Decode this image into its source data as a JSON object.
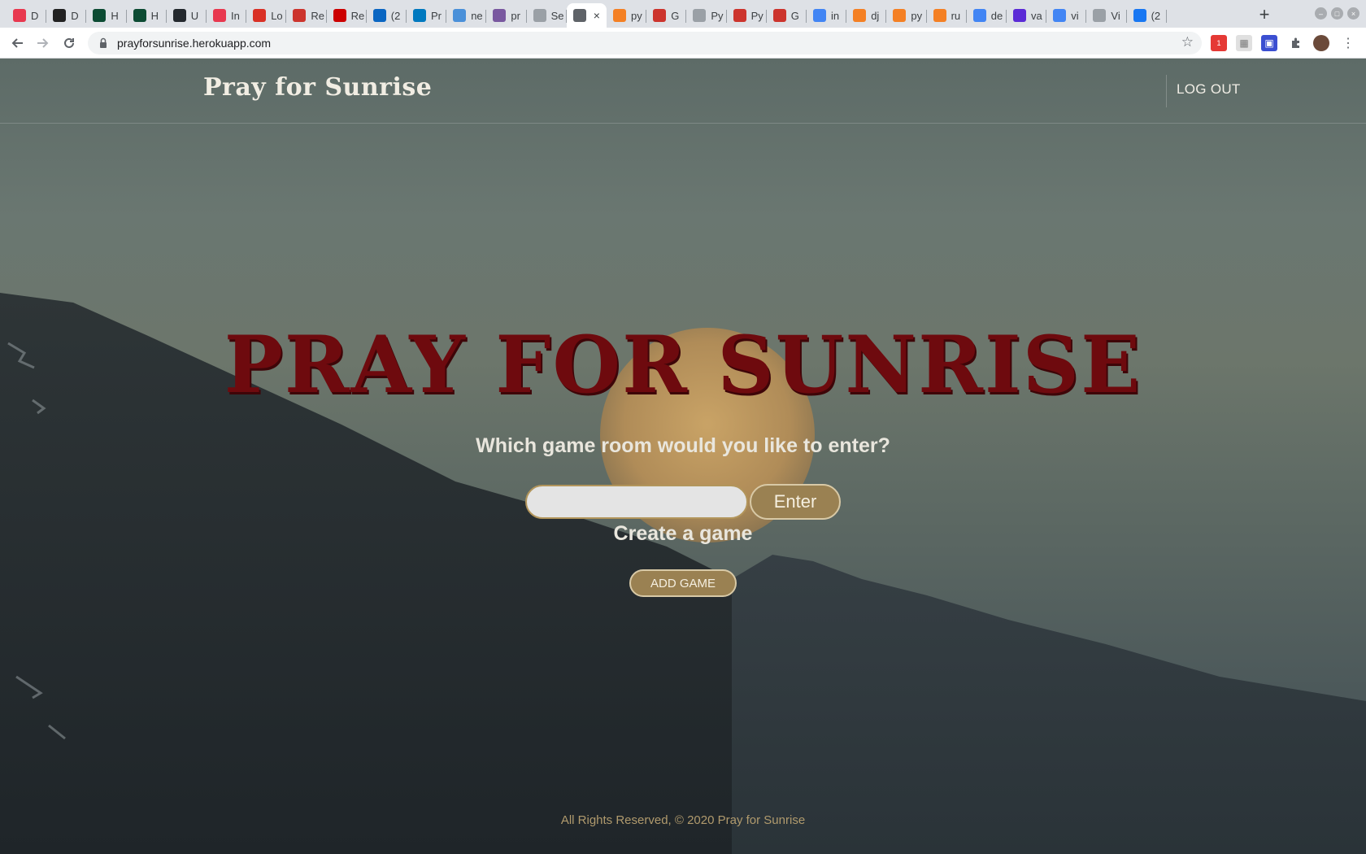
{
  "browser": {
    "tabs": [
      {
        "icon": "asana-icon",
        "label": "D",
        "color": "#e8384f"
      },
      {
        "icon": "medium-icon",
        "label": "D",
        "color": "#222222"
      },
      {
        "icon": "django-icon",
        "label": "H",
        "color": "#0c4b33"
      },
      {
        "icon": "django-icon",
        "label": "H",
        "color": "#0c4b33"
      },
      {
        "icon": "github-icon",
        "label": "U",
        "color": "#24292e"
      },
      {
        "icon": "asana-icon",
        "label": "In",
        "color": "#e8384f"
      },
      {
        "icon": "gmail-icon",
        "label": "Lo",
        "color": "#d93025"
      },
      {
        "icon": "ruby-icon",
        "label": "Re",
        "color": "#cc342d"
      },
      {
        "icon": "rails-icon",
        "label": "Re",
        "color": "#cc0000"
      },
      {
        "icon": "linkedin-icon",
        "label": "(2",
        "color": "#0a66c2"
      },
      {
        "icon": "trello-icon",
        "label": "Pr",
        "color": "#0079bf"
      },
      {
        "icon": "globe-icon",
        "label": "ne",
        "color": "#4a90d9"
      },
      {
        "icon": "heroku-icon",
        "label": "pr",
        "color": "#79589f"
      },
      {
        "icon": "github-icon",
        "label": "Se",
        "color": "#9aa0a6"
      },
      {
        "icon": "globe-icon",
        "label": "",
        "color": "#5f6368"
      },
      {
        "icon": "stackoverflow-icon",
        "label": "py",
        "color": "#f48024"
      },
      {
        "icon": "ruby-icon",
        "label": "G",
        "color": "#cc342d"
      },
      {
        "icon": "github-icon",
        "label": "Py",
        "color": "#9aa0a6"
      },
      {
        "icon": "ruby-icon",
        "label": "Py",
        "color": "#cc342d"
      },
      {
        "icon": "ruby-icon",
        "label": "G",
        "color": "#cc342d"
      },
      {
        "icon": "google-icon",
        "label": "in",
        "color": "#4285f4"
      },
      {
        "icon": "stackoverflow-icon",
        "label": "dj",
        "color": "#f48024"
      },
      {
        "icon": "stackoverflow-icon",
        "label": "py",
        "color": "#f48024"
      },
      {
        "icon": "stackoverflow-icon",
        "label": "ru",
        "color": "#f48024"
      },
      {
        "icon": "google-icon",
        "label": "de",
        "color": "#4285f4"
      },
      {
        "icon": "moon-icon",
        "label": "va",
        "color": "#5b2bd6"
      },
      {
        "icon": "google-icon",
        "label": "vi",
        "color": "#4285f4"
      },
      {
        "icon": "globe-icon",
        "label": "Vi",
        "color": "#9aa0a6"
      },
      {
        "icon": "facebook-icon",
        "label": "(2",
        "color": "#1877f2"
      }
    ],
    "url": "prayforsunrise.herokuapp.com",
    "extension_badge": "1"
  },
  "site": {
    "logo": "Pray for Sunrise",
    "logout": "LOG OUT",
    "hero_title": "PRAY FOR SUNRISE",
    "question": "Which game room would you like to enter?",
    "room_input_value": "",
    "enter_label": "Enter",
    "create_label": "Create a game",
    "add_game_label": "ADD GAME",
    "footer": "All Rights Reserved, © 2020 Pray for Sunrise"
  },
  "colors": {
    "accent_gold": "#9a8152",
    "title_red": "#6e0a0e",
    "footer_gold": "#b09a6d"
  }
}
